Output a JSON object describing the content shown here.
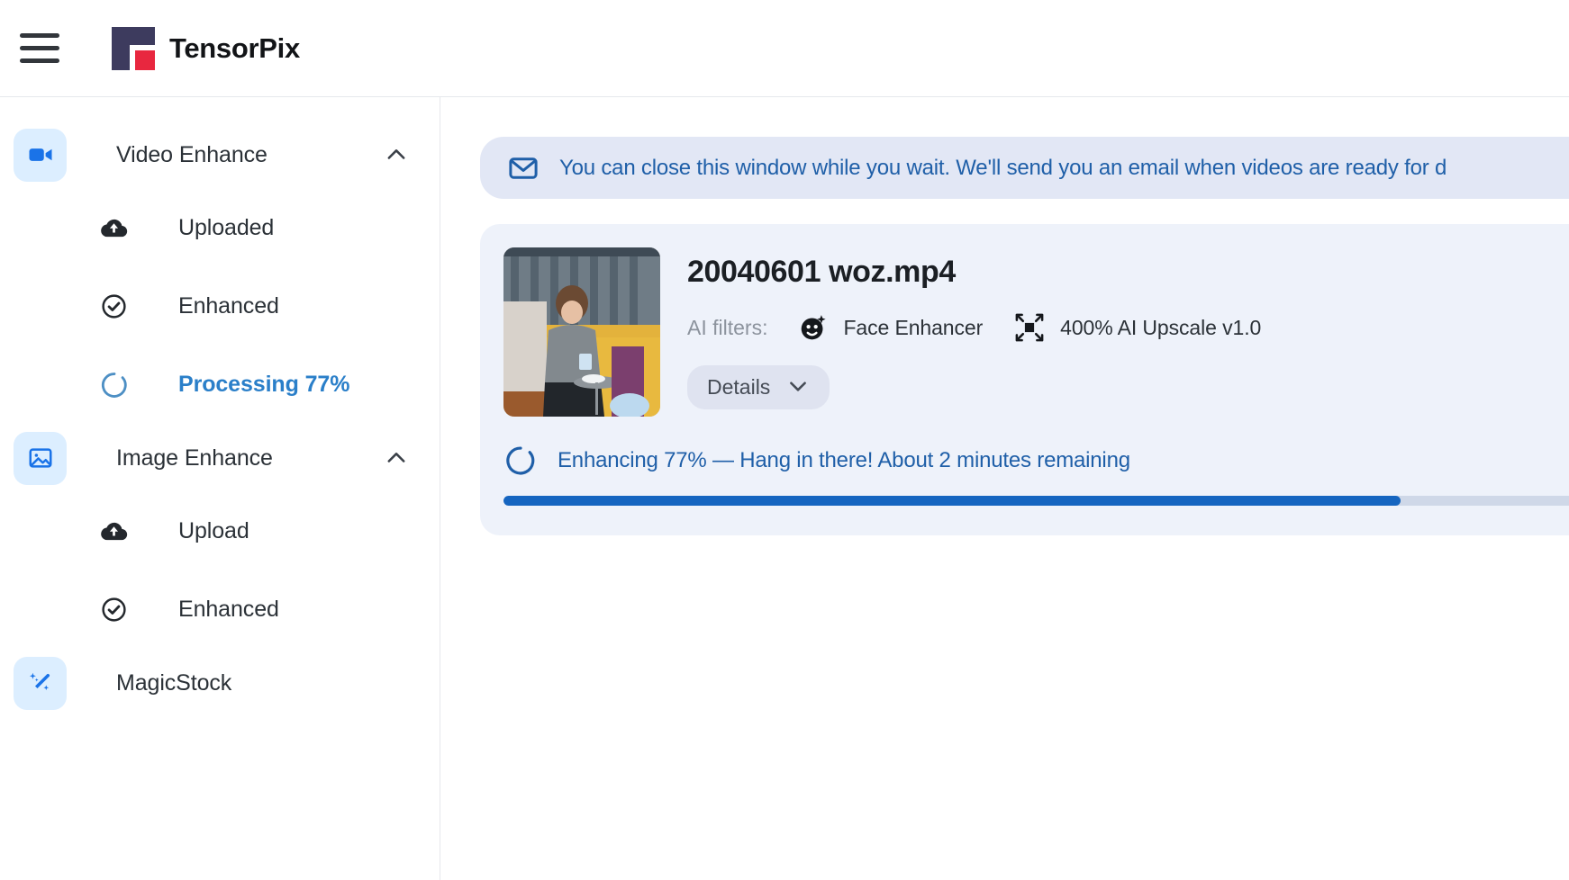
{
  "header": {
    "menu_icon": "hamburger-icon",
    "brand_name": "TensorPix",
    "logo_colors": {
      "mark": "#3d3b5e",
      "accent": "#e8273f"
    }
  },
  "sidebar": {
    "groups": [
      {
        "label": "Video Enhance",
        "icon": "video-camera-icon",
        "expanded": true,
        "chevron": "chevron-up-icon",
        "items": [
          {
            "label": "Uploaded",
            "icon": "cloud-upload-icon",
            "active": false
          },
          {
            "label": "Enhanced",
            "icon": "check-circle-icon",
            "active": false
          },
          {
            "label": "Processing 77%",
            "icon": "spinner-icon",
            "active": true
          }
        ]
      },
      {
        "label": "Image Enhance",
        "icon": "image-icon",
        "expanded": true,
        "chevron": "chevron-up-icon",
        "items": [
          {
            "label": "Upload",
            "icon": "cloud-upload-icon",
            "active": false
          },
          {
            "label": "Enhanced",
            "icon": "check-circle-icon",
            "active": false
          }
        ]
      }
    ],
    "flat_items": [
      {
        "label": "MagicStock",
        "icon": "magic-wand-icon"
      }
    ]
  },
  "main": {
    "banner": {
      "icon": "envelope-icon",
      "text": "You can close this window while you wait. We'll send you an email when videos are ready for d",
      "color": "#1f5fa8",
      "background": "#e2e7f5"
    },
    "card": {
      "thumbnail_alt": "video-thumbnail",
      "file_name": "20040601 woz.mp4",
      "filters_label": "AI filters:",
      "filters": [
        {
          "label": "Face Enhancer",
          "icon": "face-sparkle-icon"
        },
        {
          "label": "400% AI Upscale v1.0",
          "icon": "upscale-arrows-icon"
        }
      ],
      "details_button": {
        "label": "Details",
        "chevron": "chevron-down-icon"
      },
      "status": {
        "icon": "spinner-icon",
        "text": "Enhancing 77% — Hang in there! About 2 minutes remaining",
        "percent": 77,
        "bar_color": "#1565c0",
        "track_color": "#cfd8e8"
      }
    }
  }
}
